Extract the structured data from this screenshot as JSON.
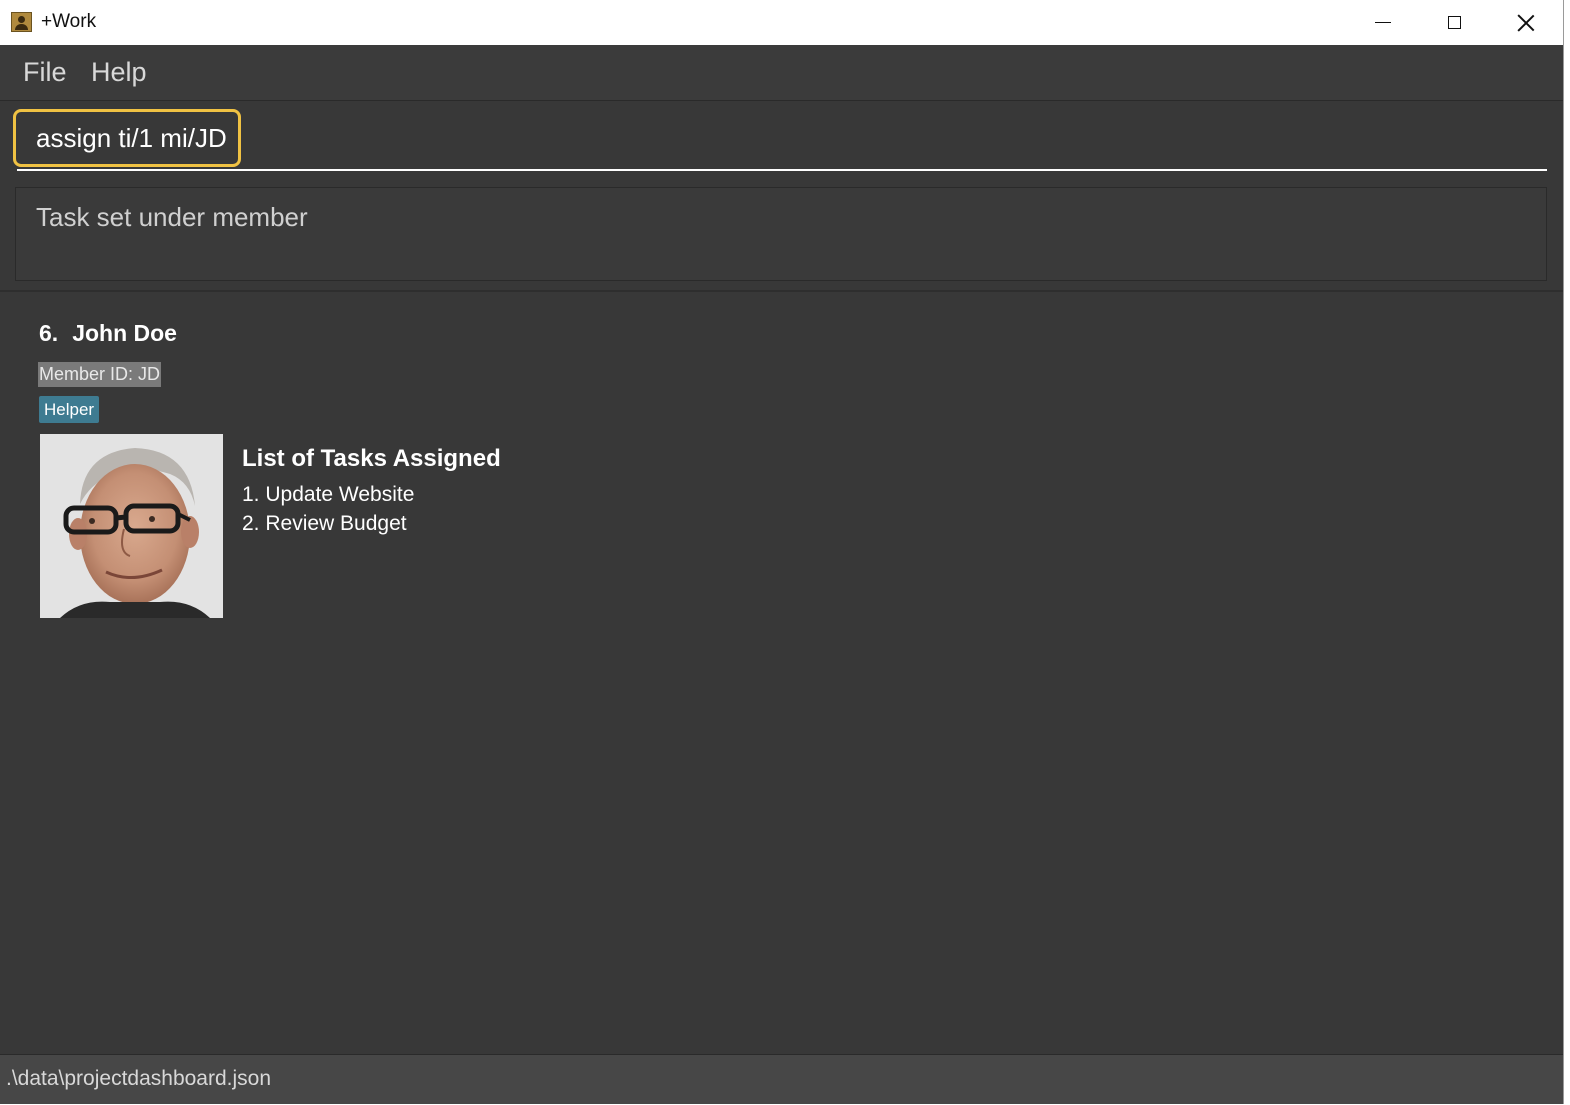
{
  "window": {
    "title": "+Work"
  },
  "menu": {
    "file_label": "File",
    "help_label": "Help"
  },
  "command": {
    "value": "assign ti/1 mi/JD"
  },
  "result": {
    "message": "Task set under member"
  },
  "member": {
    "index": "6.",
    "name": "John Doe",
    "member_id": "Member ID: JD",
    "role": "Helper",
    "tasks_title": "List of Tasks Assigned",
    "tasks": [
      "1. Update Website",
      "2. Review Budget"
    ]
  },
  "status": {
    "file_path": ".\\data\\projectdashboard.json"
  },
  "colors": {
    "background": "#383838",
    "accent_border": "#f0c243",
    "role_badge": "#3e7b91"
  }
}
